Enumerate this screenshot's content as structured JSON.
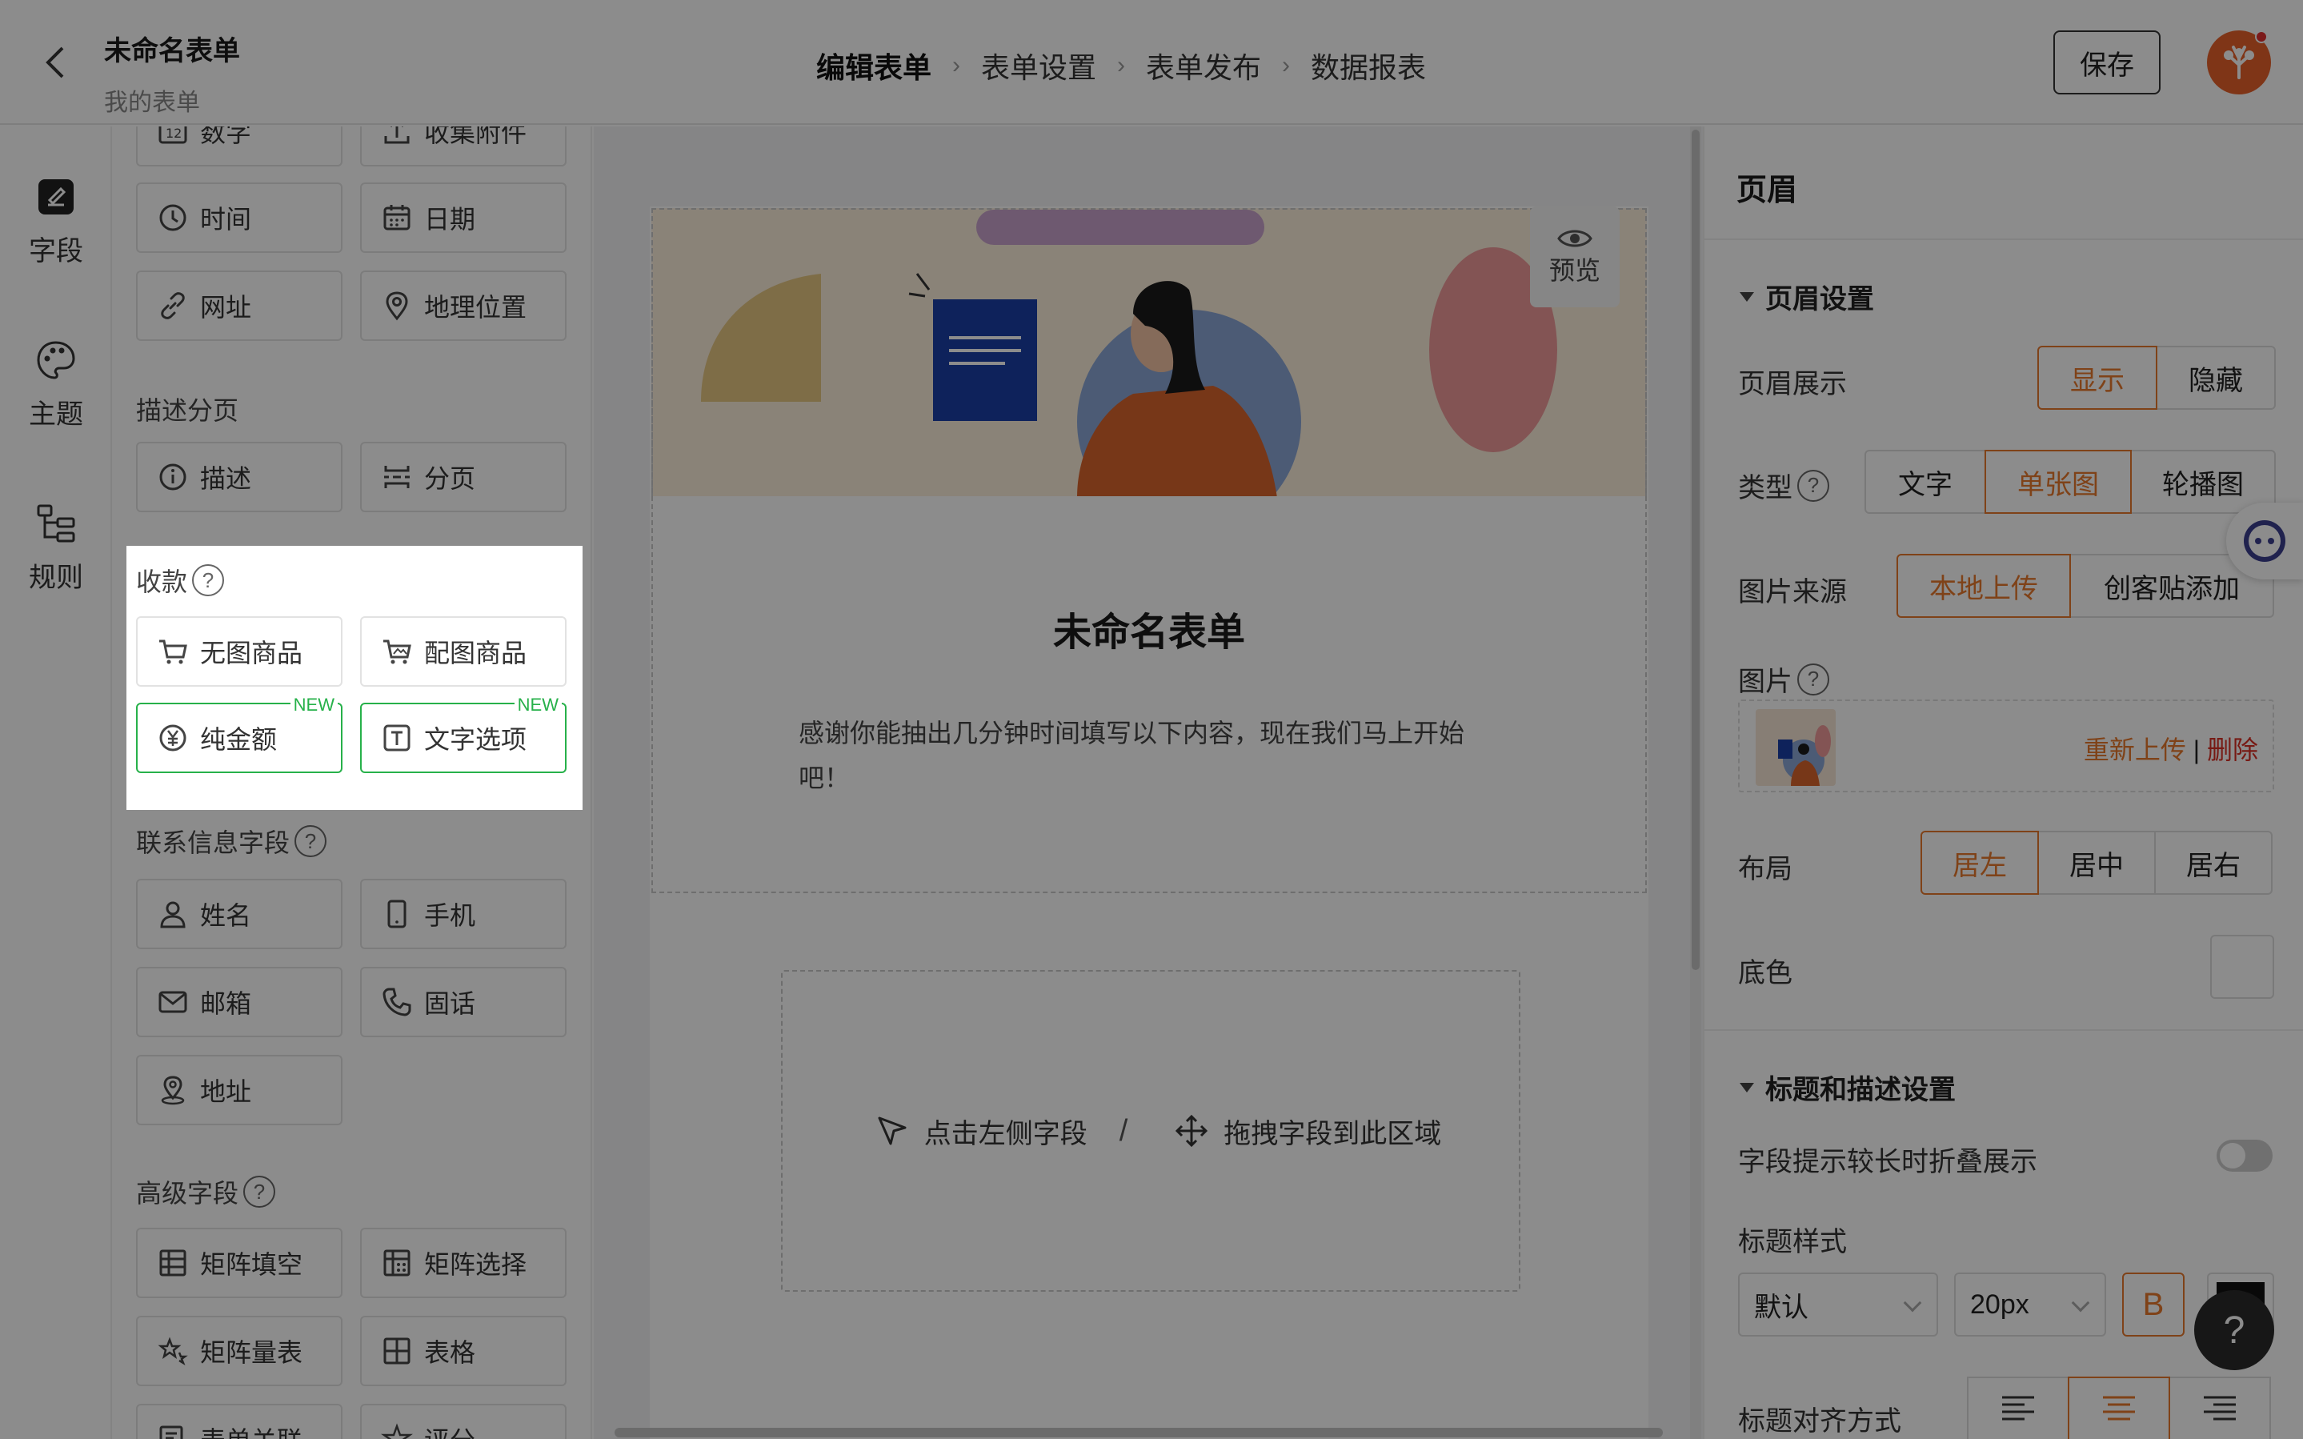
{
  "header": {
    "title": "未命名表单",
    "subtitle": "我的表单",
    "steps": [
      "编辑表单",
      "表单设置",
      "表单发布",
      "数据报表"
    ],
    "save_label": "保存"
  },
  "rail": {
    "items": [
      {
        "label": "字段",
        "icon": "field-icon"
      },
      {
        "label": "主题",
        "icon": "palette-icon"
      },
      {
        "label": "规则",
        "icon": "rules-icon"
      }
    ]
  },
  "fields_panel": {
    "top_row": [
      "数字",
      "收集附件"
    ],
    "row_time": [
      "时间",
      "日期"
    ],
    "row_url": [
      "网址",
      "地理位置"
    ],
    "desc_section": "描述分页",
    "desc_items": [
      "描述",
      "分页"
    ],
    "payment_section": "收款",
    "payment_items": [
      "无图商品",
      "配图商品",
      "纯金额",
      "文字选项"
    ],
    "new_badge": "NEW",
    "contact_section": "联系信息字段",
    "contact_items": [
      "姓名",
      "手机",
      "邮箱",
      "固话",
      "地址"
    ],
    "advanced_section": "高级字段",
    "advanced_items": [
      "矩阵填空",
      "矩阵选择",
      "矩阵量表",
      "表格",
      "表单关联",
      "评分"
    ]
  },
  "canvas": {
    "preview_label": "预览",
    "form_title": "未命名表单",
    "form_desc": "感谢你能抽出几分钟时间填写以下内容，现在我们马上开始吧！",
    "dropzone_left": "点击左侧字段",
    "dropzone_sep": "/",
    "dropzone_right": "拖拽字段到此区域"
  },
  "props": {
    "title": "页眉",
    "header_settings": "页眉设置",
    "display_label": "页眉展示",
    "display_options": [
      "显示",
      "隐藏"
    ],
    "display_selected": "显示",
    "type_label": "类型",
    "type_options": [
      "文字",
      "单张图",
      "轮播图"
    ],
    "type_selected": "单张图",
    "source_label": "图片来源",
    "source_options": [
      "本地上传",
      "创客贴添加"
    ],
    "source_selected": "本地上传",
    "image_label": "图片",
    "reupload": "重新上传",
    "divider": "|",
    "delete": "删除",
    "layout_label": "布局",
    "layout_options": [
      "居左",
      "居中",
      "居右"
    ],
    "layout_selected": "居左",
    "bgcolor_label": "底色",
    "title_desc_settings": "标题和描述设置",
    "collapse_label": "字段提示较长时折叠展示",
    "collapse_on": false,
    "title_style_label": "标题样式",
    "font_select": "默认",
    "size_select": "20px",
    "bold_label": "B",
    "align_label": "标题对齐方式",
    "align_selected": "center"
  },
  "colors": {
    "accent": "#e8782d",
    "new_green": "#27b14a",
    "delete_red": "#d93026"
  }
}
